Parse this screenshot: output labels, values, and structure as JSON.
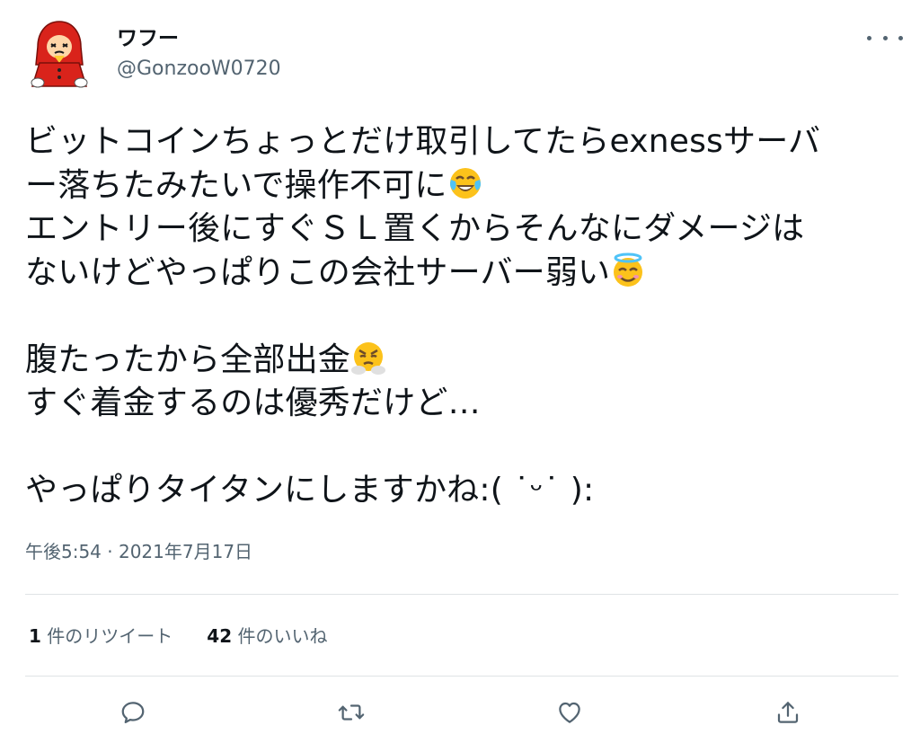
{
  "user": {
    "display_name": "ワフー",
    "handle": "@GonzooW0720"
  },
  "tweet": {
    "lines": [
      "ビットコインちょっとだけ取引してたらexnessサーバ",
      "ー落ちたみたいで操作不可に",
      "エントリー後にすぐＳＬ置くからそんなにダメージは",
      "ないけどやっぱりこの会社サーバー弱い",
      "",
      "腹たったから全部出金",
      "すぐ着金するのは優秀だけど…",
      "",
      "やっぱりタイタンにしますかね:( ˙ᵕ˙ ):"
    ],
    "emojis": [
      "face-with-tears-of-joy-emoji",
      "smiling-face-with-halo-emoji",
      "face-with-steam-from-nose-emoji"
    ],
    "timestamp": "午後5:54 · 2021年7月17日"
  },
  "stats": {
    "retweets_count": "1",
    "retweets_label": " 件のリツイート",
    "likes_count": "42",
    "likes_label": " 件のいいね"
  },
  "actions": [
    "reply-icon",
    "retweet-icon",
    "like-icon",
    "share-icon"
  ],
  "colors": {
    "text": "#0f1419",
    "secondary": "#536471",
    "divider": "#dfe3e6",
    "avatar_red": "#d9231b"
  }
}
